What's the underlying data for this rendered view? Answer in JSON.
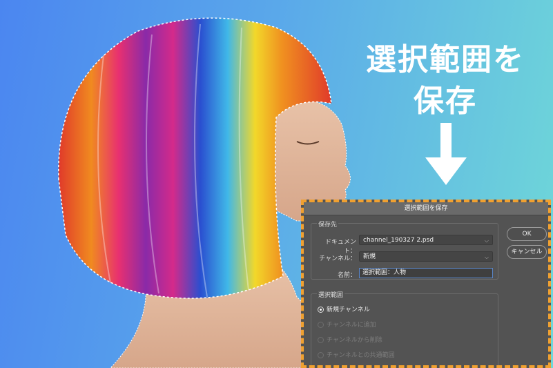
{
  "headline": {
    "line1": "選択範囲を",
    "line2": "保存"
  },
  "colors": {
    "background_start": "#4b86f0",
    "background_end": "#6fd8d8",
    "dialog_border": "#f0a030",
    "dialog_bg": "#535353"
  },
  "dialog": {
    "title": "選択範囲を保存",
    "destination": {
      "group_title": "保存先",
      "document_label": "ドキュメント：",
      "document_value": "channel_190327 2.psd",
      "channel_label": "チャンネル：",
      "channel_value": "新規",
      "name_label": "名前：",
      "name_value": "選択範囲：人物"
    },
    "selection": {
      "group_title": "選択範囲",
      "options": [
        {
          "label": "新規チャンネル",
          "selected": true,
          "enabled": true
        },
        {
          "label": "チャンネルに追加",
          "selected": false,
          "enabled": false
        },
        {
          "label": "チャンネルから削除",
          "selected": false,
          "enabled": false
        },
        {
          "label": "チャンネルとの共通範囲",
          "selected": false,
          "enabled": false
        }
      ]
    },
    "ok_label": "OK",
    "cancel_label": "キャンセル"
  }
}
